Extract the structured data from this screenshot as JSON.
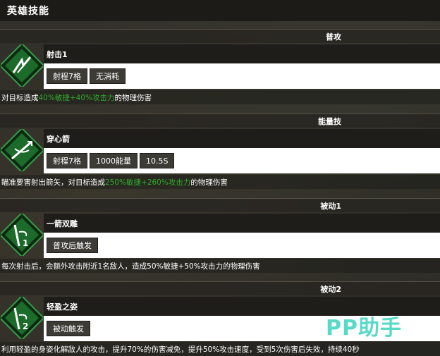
{
  "header": {
    "title": "英雄技能"
  },
  "sections": [
    {
      "category": "普攻",
      "icon": "arrow-shot-icon",
      "name": "射击1",
      "tags": [
        "射程7格",
        "无消耗"
      ],
      "desc_pre": "对目标造成",
      "desc_hl": "40%敏捷+40%攻击力",
      "desc_post": "的物理伤害"
    },
    {
      "category": "能量技",
      "icon": "piercing-arrow-icon",
      "name": "穿心箭",
      "tags": [
        "射程7格",
        "1000能量",
        "10.5S"
      ],
      "desc_pre": "瞄准要害射出箭矢，对目标造成",
      "desc_hl": "250%敏捷+260%攻击力",
      "desc_post": "的物理伤害"
    },
    {
      "category": "被动1",
      "icon": "passive-1-icon",
      "name": "一箭双雕",
      "tags": [
        "普攻后触发"
      ],
      "desc_pre": "每次射击后，会额外攻击附近1名敌人，造成50%敏捷+50%攻击力的物理伤害",
      "desc_hl": "",
      "desc_post": ""
    },
    {
      "category": "被动2",
      "icon": "passive-2-icon",
      "name": "轻盈之姿",
      "tags": [
        "被动触发"
      ],
      "desc_pre": "利用轻盈的身姿化解敌人的攻击，提升70%的伤害减免，提升50%攻击速度，受到5次伤害后失效，持续40秒",
      "desc_hl": "",
      "desc_post": ""
    }
  ],
  "watermark": "PP助手",
  "colors": {
    "highlight": "#2eab2e",
    "icon_green": "#1f7a2c",
    "watermark": "#48d6c2"
  }
}
